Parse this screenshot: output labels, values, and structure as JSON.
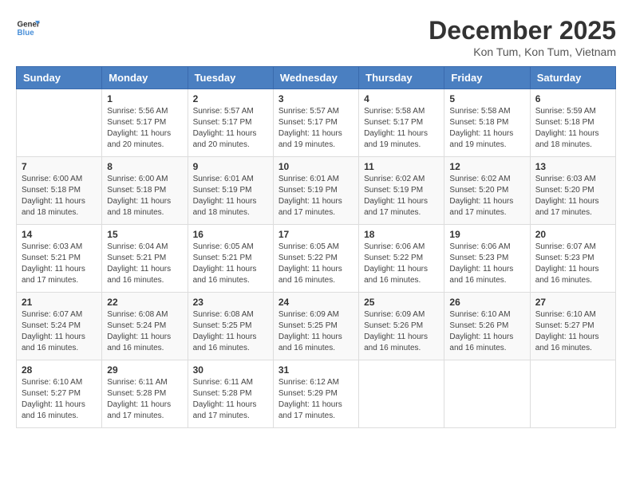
{
  "header": {
    "logo_general": "General",
    "logo_blue": "Blue",
    "title": "December 2025",
    "location": "Kon Tum, Kon Tum, Vietnam"
  },
  "calendar": {
    "days_of_week": [
      "Sunday",
      "Monday",
      "Tuesday",
      "Wednesday",
      "Thursday",
      "Friday",
      "Saturday"
    ],
    "weeks": [
      [
        {
          "day": "",
          "info": ""
        },
        {
          "day": "1",
          "info": "Sunrise: 5:56 AM\nSunset: 5:17 PM\nDaylight: 11 hours\nand 20 minutes."
        },
        {
          "day": "2",
          "info": "Sunrise: 5:57 AM\nSunset: 5:17 PM\nDaylight: 11 hours\nand 20 minutes."
        },
        {
          "day": "3",
          "info": "Sunrise: 5:57 AM\nSunset: 5:17 PM\nDaylight: 11 hours\nand 19 minutes."
        },
        {
          "day": "4",
          "info": "Sunrise: 5:58 AM\nSunset: 5:17 PM\nDaylight: 11 hours\nand 19 minutes."
        },
        {
          "day": "5",
          "info": "Sunrise: 5:58 AM\nSunset: 5:18 PM\nDaylight: 11 hours\nand 19 minutes."
        },
        {
          "day": "6",
          "info": "Sunrise: 5:59 AM\nSunset: 5:18 PM\nDaylight: 11 hours\nand 18 minutes."
        }
      ],
      [
        {
          "day": "7",
          "info": "Sunrise: 6:00 AM\nSunset: 5:18 PM\nDaylight: 11 hours\nand 18 minutes."
        },
        {
          "day": "8",
          "info": "Sunrise: 6:00 AM\nSunset: 5:18 PM\nDaylight: 11 hours\nand 18 minutes."
        },
        {
          "day": "9",
          "info": "Sunrise: 6:01 AM\nSunset: 5:19 PM\nDaylight: 11 hours\nand 18 minutes."
        },
        {
          "day": "10",
          "info": "Sunrise: 6:01 AM\nSunset: 5:19 PM\nDaylight: 11 hours\nand 17 minutes."
        },
        {
          "day": "11",
          "info": "Sunrise: 6:02 AM\nSunset: 5:19 PM\nDaylight: 11 hours\nand 17 minutes."
        },
        {
          "day": "12",
          "info": "Sunrise: 6:02 AM\nSunset: 5:20 PM\nDaylight: 11 hours\nand 17 minutes."
        },
        {
          "day": "13",
          "info": "Sunrise: 6:03 AM\nSunset: 5:20 PM\nDaylight: 11 hours\nand 17 minutes."
        }
      ],
      [
        {
          "day": "14",
          "info": "Sunrise: 6:03 AM\nSunset: 5:21 PM\nDaylight: 11 hours\nand 17 minutes."
        },
        {
          "day": "15",
          "info": "Sunrise: 6:04 AM\nSunset: 5:21 PM\nDaylight: 11 hours\nand 16 minutes."
        },
        {
          "day": "16",
          "info": "Sunrise: 6:05 AM\nSunset: 5:21 PM\nDaylight: 11 hours\nand 16 minutes."
        },
        {
          "day": "17",
          "info": "Sunrise: 6:05 AM\nSunset: 5:22 PM\nDaylight: 11 hours\nand 16 minutes."
        },
        {
          "day": "18",
          "info": "Sunrise: 6:06 AM\nSunset: 5:22 PM\nDaylight: 11 hours\nand 16 minutes."
        },
        {
          "day": "19",
          "info": "Sunrise: 6:06 AM\nSunset: 5:23 PM\nDaylight: 11 hours\nand 16 minutes."
        },
        {
          "day": "20",
          "info": "Sunrise: 6:07 AM\nSunset: 5:23 PM\nDaylight: 11 hours\nand 16 minutes."
        }
      ],
      [
        {
          "day": "21",
          "info": "Sunrise: 6:07 AM\nSunset: 5:24 PM\nDaylight: 11 hours\nand 16 minutes."
        },
        {
          "day": "22",
          "info": "Sunrise: 6:08 AM\nSunset: 5:24 PM\nDaylight: 11 hours\nand 16 minutes."
        },
        {
          "day": "23",
          "info": "Sunrise: 6:08 AM\nSunset: 5:25 PM\nDaylight: 11 hours\nand 16 minutes."
        },
        {
          "day": "24",
          "info": "Sunrise: 6:09 AM\nSunset: 5:25 PM\nDaylight: 11 hours\nand 16 minutes."
        },
        {
          "day": "25",
          "info": "Sunrise: 6:09 AM\nSunset: 5:26 PM\nDaylight: 11 hours\nand 16 minutes."
        },
        {
          "day": "26",
          "info": "Sunrise: 6:10 AM\nSunset: 5:26 PM\nDaylight: 11 hours\nand 16 minutes."
        },
        {
          "day": "27",
          "info": "Sunrise: 6:10 AM\nSunset: 5:27 PM\nDaylight: 11 hours\nand 16 minutes."
        }
      ],
      [
        {
          "day": "28",
          "info": "Sunrise: 6:10 AM\nSunset: 5:27 PM\nDaylight: 11 hours\nand 16 minutes."
        },
        {
          "day": "29",
          "info": "Sunrise: 6:11 AM\nSunset: 5:28 PM\nDaylight: 11 hours\nand 17 minutes."
        },
        {
          "day": "30",
          "info": "Sunrise: 6:11 AM\nSunset: 5:28 PM\nDaylight: 11 hours\nand 17 minutes."
        },
        {
          "day": "31",
          "info": "Sunrise: 6:12 AM\nSunset: 5:29 PM\nDaylight: 11 hours\nand 17 minutes."
        },
        {
          "day": "",
          "info": ""
        },
        {
          "day": "",
          "info": ""
        },
        {
          "day": "",
          "info": ""
        }
      ]
    ]
  }
}
